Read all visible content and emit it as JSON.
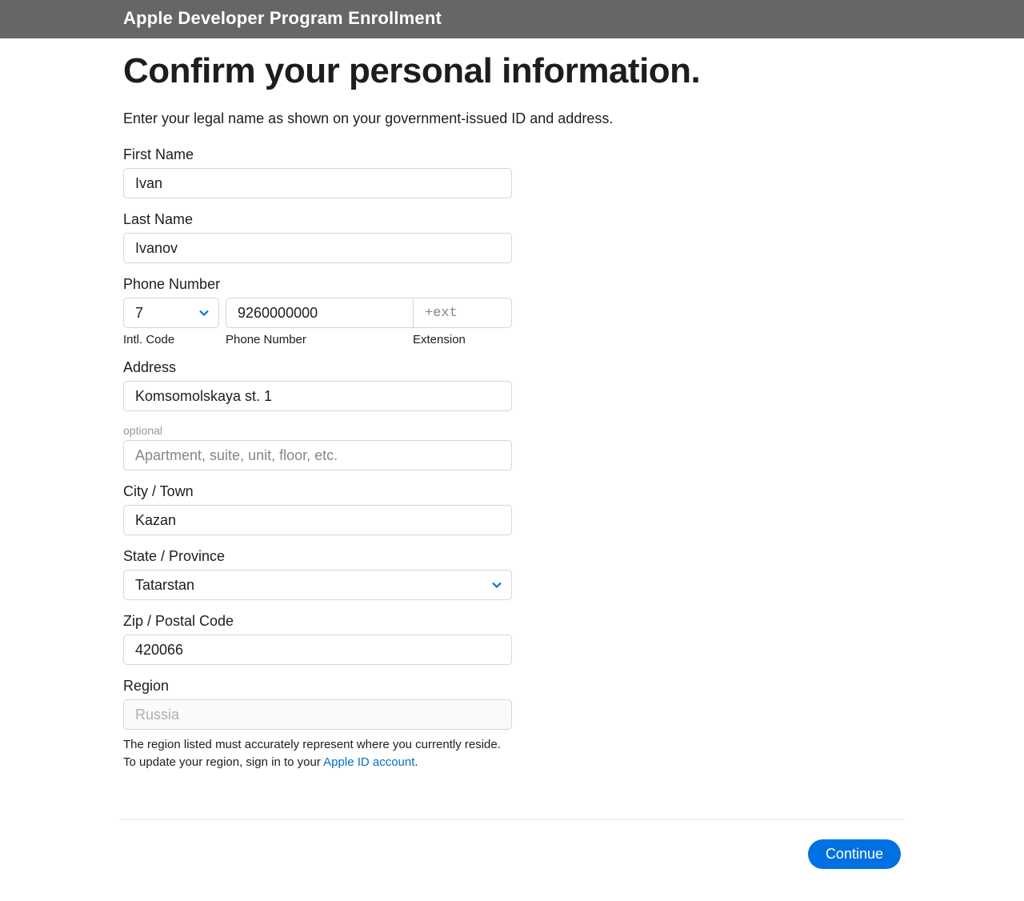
{
  "header": {
    "title": "Apple Developer Program Enrollment"
  },
  "page": {
    "title": "Confirm your personal information.",
    "description": "Enter your legal name as shown on your government-issued ID and address."
  },
  "form": {
    "first_name": {
      "label": "First Name",
      "value": "Ivan"
    },
    "last_name": {
      "label": "Last Name",
      "value": "Ivanov"
    },
    "phone": {
      "label": "Phone Number",
      "intl_code": {
        "value": "7",
        "sublabel": "Intl. Code"
      },
      "number": {
        "value": "9260000000",
        "sublabel": "Phone Number"
      },
      "ext": {
        "value": "",
        "placeholder": "+ext",
        "sublabel": "Extension"
      }
    },
    "address": {
      "label": "Address",
      "value": "Komsomolskaya st. 1"
    },
    "address2": {
      "optional_label": "optional",
      "value": "",
      "placeholder": "Apartment, suite, unit, floor, etc."
    },
    "city": {
      "label": "City / Town",
      "value": "Kazan"
    },
    "state": {
      "label": "State / Province",
      "value": "Tatarstan"
    },
    "zip": {
      "label": "Zip / Postal Code",
      "value": "420066"
    },
    "region": {
      "label": "Region",
      "value": "Russia",
      "helper_pre": "The region listed must accurately represent where you currently reside. To update your region, sign in to your ",
      "helper_link": "Apple ID account",
      "helper_post": "."
    }
  },
  "actions": {
    "continue": "Continue"
  }
}
